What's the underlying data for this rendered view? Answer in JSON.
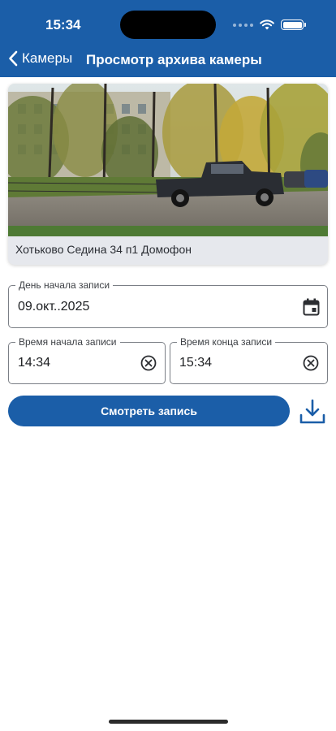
{
  "status_bar": {
    "time": "15:34",
    "icons": [
      "signal-dots-icon",
      "wifi-icon",
      "battery-icon"
    ]
  },
  "nav": {
    "back_label": "Камеры",
    "title": "Просмотр архива камеры"
  },
  "camera": {
    "name": "Хотьково Седина 34 п1 Домофон"
  },
  "form": {
    "start_date": {
      "label": "День начала записи",
      "value": "09.окт..2025",
      "icon": "calendar-icon"
    },
    "start_time": {
      "label": "Время начала записи",
      "value": "14:34",
      "icon": "clear-circle-icon"
    },
    "end_time": {
      "label": "Время конца записи",
      "value": "15:34",
      "icon": "clear-circle-icon"
    }
  },
  "actions": {
    "watch_label": "Смотреть запись",
    "download_icon": "download-icon"
  },
  "colors": {
    "brand": "#1b5ea8",
    "field_border": "#7b7f86",
    "caption_bg": "#e6e8ed"
  }
}
